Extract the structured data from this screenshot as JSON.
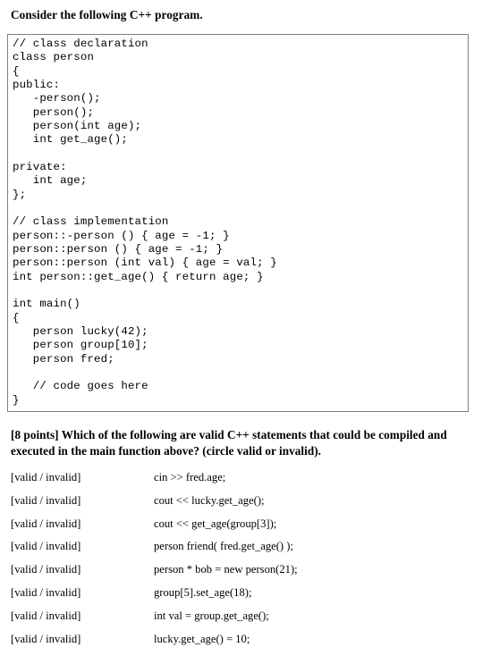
{
  "document": {
    "intro_text": "Consider the following C++ program.",
    "code_listing": "// class declaration\nclass person\n{\npublic:\n   -person();\n   person();\n   person(int age);\n   int get_age();\n\nprivate:\n   int age;\n};\n\n// class implementation\nperson::-person () { age = -1; }\nperson::person () { age = -1; }\nperson::person (int val) { age = val; }\nint person::get_age() { return age; }\n\nint main()\n{\n   person lucky(42);\n   person group[10];\n   person fred;\n\n   // code goes here\n}",
    "question": {
      "points_label": "[8 points]",
      "text": "[8 points] Which of the following are valid C++ statements that could be compiled and executed in the main function above?  (circle valid or invalid)."
    },
    "choice_label": "[valid / invalid]",
    "items": [
      {
        "choice": "[valid / invalid]",
        "statement": "cin >> fred.age;"
      },
      {
        "choice": "[valid / invalid]",
        "statement": "cout << lucky.get_age();"
      },
      {
        "choice": "[valid / invalid]",
        "statement": "cout << get_age(group[3]);"
      },
      {
        "choice": "[valid / invalid]",
        "statement": "person friend( fred.get_age() );"
      },
      {
        "choice": "[valid / invalid]",
        "statement": "person * bob = new person(21);"
      },
      {
        "choice": "[valid / invalid]",
        "statement": "group[5].set_age(18);"
      },
      {
        "choice": "[valid / invalid]",
        "statement": "int val = group.get_age();"
      },
      {
        "choice": "[valid / invalid]",
        "statement": "lucky.get_age() = 10;"
      }
    ],
    "colors": {
      "text": "#000000",
      "code_box_border": "#808080",
      "background": "#ffffff"
    }
  }
}
